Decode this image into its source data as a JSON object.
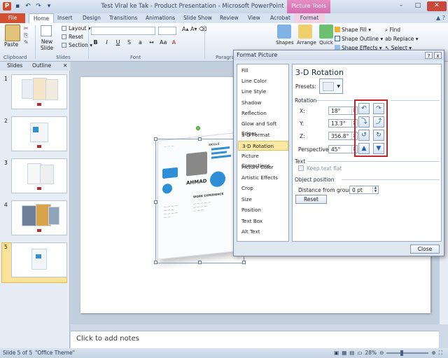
{
  "window": {
    "title": "Test Viral ke Tak - Product Presentation - Microsoft PowerPoint",
    "context_tab": "Picture Tools"
  },
  "tabs": [
    "File",
    "Home",
    "Insert",
    "Design",
    "Transitions",
    "Animations",
    "Slide Show",
    "Review",
    "View",
    "Acrobat",
    "Format"
  ],
  "ribbon": {
    "paste": "Paste",
    "clipboard": "Clipboard",
    "new_slide": "New Slide",
    "layout": "Layout",
    "reset": "Reset",
    "section": "Section",
    "slides_group": "Slides",
    "font_group": "Font",
    "paragraph_group": "Paragra",
    "shapes": "Shapes",
    "arrange": "Arrange",
    "quick_styles": "Quick",
    "shape_fill": "Shape Fill",
    "shape_outline": "Shape Outline",
    "shape_effects": "Shape Effects",
    "find": "Find",
    "replace": "Replace",
    "select": "Select"
  },
  "left_panel": {
    "tab_slides": "Slides",
    "tab_outline": "Outline",
    "slide_numbers": [
      "1",
      "2",
      "3",
      "4",
      "5"
    ]
  },
  "resume": {
    "name": "AHMAD",
    "section": "WORK EXPERIENCE",
    "skills": "SKILLS"
  },
  "notes": {
    "placeholder": "Click to add notes"
  },
  "dialog": {
    "title": "Format Picture",
    "help": "?",
    "close_x": "x",
    "nav_items": [
      "Fill",
      "Line Color",
      "Line Style",
      "Shadow",
      "Reflection",
      "Glow and Soft Edges",
      "3-D Format",
      "3-D Rotation",
      "Picture Corrections",
      "Picture Color",
      "Artistic Effects",
      "Crop",
      "Size",
      "Position",
      "Text Box",
      "Alt Text"
    ],
    "active_item": "3-D Rotation",
    "panel_title": "3-D Rotation",
    "presets_label": "Presets:",
    "rotation_label": "Rotation",
    "x_label": "X:",
    "x_value": "18°",
    "y_label": "Y:",
    "y_value": "13.3°",
    "z_label": "Z:",
    "z_value": "356.8°",
    "perspective_label": "Perspective:",
    "perspective_value": "45°",
    "text_section": "Text",
    "keep_text_flat": "Keep text flat",
    "object_position": "Object position",
    "distance_label": "Distance from ground:",
    "distance_value": "0 pt",
    "reset_button": "Reset",
    "close_button": "Close"
  },
  "status": {
    "slide_info": "Slide 5 of 5",
    "theme": "\"Office Theme\"",
    "zoom": "28%"
  }
}
